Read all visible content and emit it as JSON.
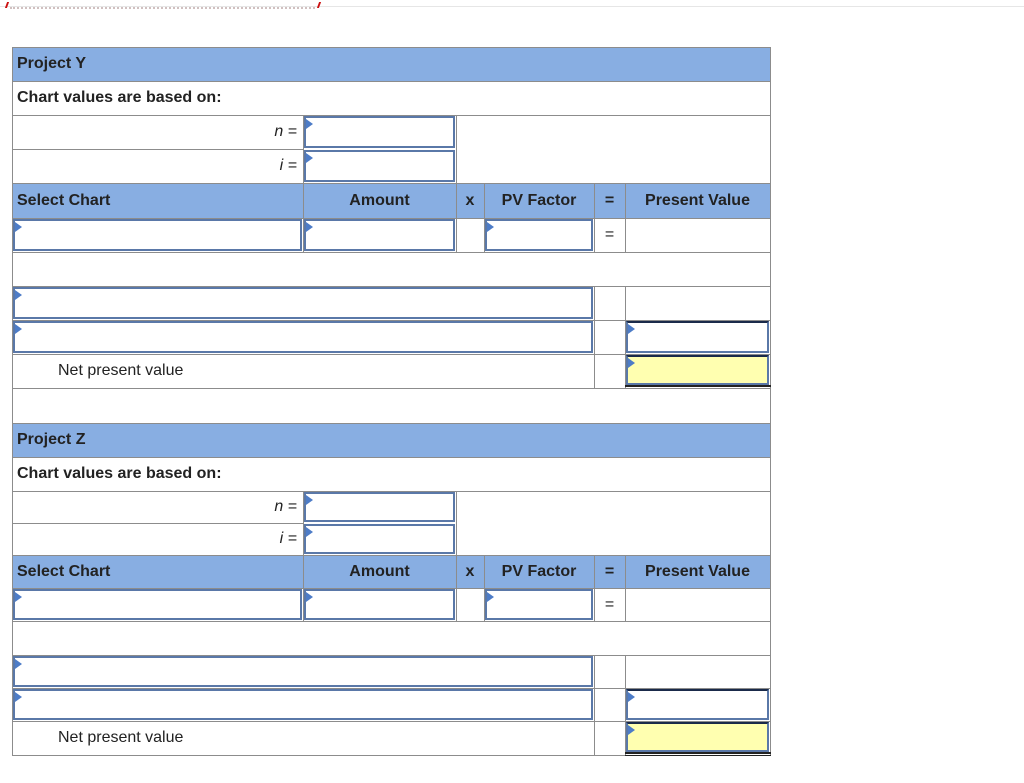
{
  "projects": [
    {
      "title": "Project Y",
      "chart_values_label": "Chart values are based on:",
      "n_label": "n =",
      "i_label": "i =",
      "n_value": "",
      "i_value": "",
      "columns": {
        "select_chart": "Select Chart",
        "amount": "Amount",
        "times": "x",
        "pv_factor": "PV Factor",
        "equals": "=",
        "present_value": "Present Value"
      },
      "row_equals": "=",
      "net_present_value_label": "Net present value"
    },
    {
      "title": "Project Z",
      "chart_values_label": "Chart values are based on:",
      "n_label": "n =",
      "i_label": "i =",
      "n_value": "",
      "i_value": "",
      "columns": {
        "select_chart": "Select Chart",
        "amount": "Amount",
        "times": "x",
        "pv_factor": "PV Factor",
        "equals": "=",
        "present_value": "Present Value"
      },
      "row_equals": "=",
      "net_present_value_label": "Net present value"
    }
  ],
  "colors": {
    "header_bg": "#88aee2",
    "input_border": "#5a78a8",
    "npv_highlight": "#ffffb0",
    "flag": "#4d7cc7"
  }
}
